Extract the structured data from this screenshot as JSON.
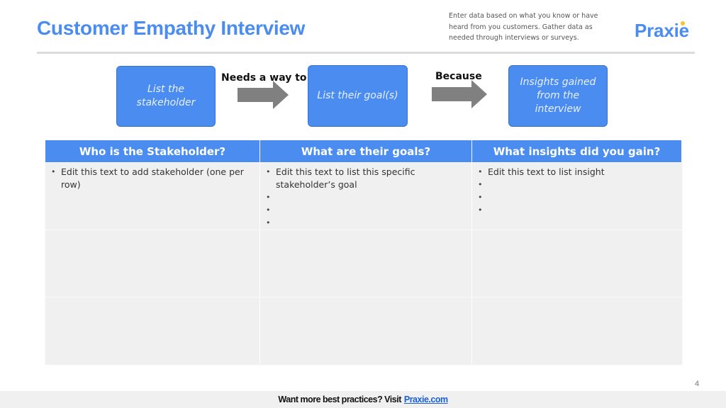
{
  "header": {
    "title": "Customer Empathy Interview",
    "instructions": "Enter data based on what you know or have heard from you customers. Gather data as needed through interviews or surveys.",
    "logo_text": "Praxie"
  },
  "flow": {
    "boxes": [
      {
        "label": "List the stakeholder"
      },
      {
        "label": "List their goal(s)"
      },
      {
        "label": "Insights gained from the interview"
      }
    ],
    "connectors": [
      {
        "label": "Needs a way to"
      },
      {
        "label": "Because"
      }
    ],
    "colors": {
      "box": "#4a8cf0",
      "arrow": "#808080"
    }
  },
  "table": {
    "headers": [
      "Who is the Stakeholder?",
      "What are their goals?",
      "What insights did you gain?"
    ],
    "rows": [
      [
        [
          "Edit this text to add stakeholder (one per row)"
        ],
        [
          "Edit this text to list this specific stakeholder’s goal",
          "",
          "",
          ""
        ],
        [
          "Edit this text to list insight",
          "",
          "",
          ""
        ]
      ],
      [
        [],
        [],
        []
      ],
      [
        [],
        [],
        []
      ]
    ]
  },
  "page_number": "4",
  "footer": {
    "text": "Want more best practices? Visit",
    "link_text": "Praxie.com"
  }
}
